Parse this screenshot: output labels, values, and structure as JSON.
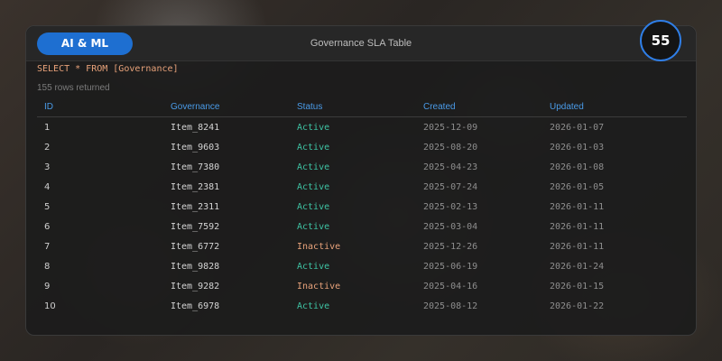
{
  "header": {
    "category_label": "AI & ML",
    "title": "Governance SLA Table",
    "score": "55"
  },
  "query": {
    "text": "SELECT * FROM [Governance]",
    "row_count_text": "155 rows returned"
  },
  "table": {
    "columns": [
      "ID",
      "Governance",
      "Status",
      "Created",
      "Updated"
    ],
    "rows": [
      {
        "id": "1",
        "governance": "Item_8241",
        "status": "Active",
        "created": "2025-12-09",
        "updated": "2026-01-07"
      },
      {
        "id": "2",
        "governance": "Item_9603",
        "status": "Active",
        "created": "2025-08-20",
        "updated": "2026-01-03"
      },
      {
        "id": "3",
        "governance": "Item_7380",
        "status": "Active",
        "created": "2025-04-23",
        "updated": "2026-01-08"
      },
      {
        "id": "4",
        "governance": "Item_2381",
        "status": "Active",
        "created": "2025-07-24",
        "updated": "2026-01-05"
      },
      {
        "id": "5",
        "governance": "Item_2311",
        "status": "Active",
        "created": "2025-02-13",
        "updated": "2026-01-11"
      },
      {
        "id": "6",
        "governance": "Item_7592",
        "status": "Active",
        "created": "2025-03-04",
        "updated": "2026-01-11"
      },
      {
        "id": "7",
        "governance": "Item_6772",
        "status": "Inactive",
        "created": "2025-12-26",
        "updated": "2026-01-11"
      },
      {
        "id": "8",
        "governance": "Item_9828",
        "status": "Active",
        "created": "2025-06-19",
        "updated": "2026-01-24"
      },
      {
        "id": "9",
        "governance": "Item_9282",
        "status": "Inactive",
        "created": "2025-04-16",
        "updated": "2026-01-15"
      },
      {
        "id": "10",
        "governance": "Item_6978",
        "status": "Active",
        "created": "2025-08-12",
        "updated": "2026-01-22"
      }
    ]
  },
  "colors": {
    "accent": "#1e6fd1",
    "header_text": "#4a9be8",
    "status_active": "#3ec3a3",
    "status_inactive": "#e8a27a"
  }
}
